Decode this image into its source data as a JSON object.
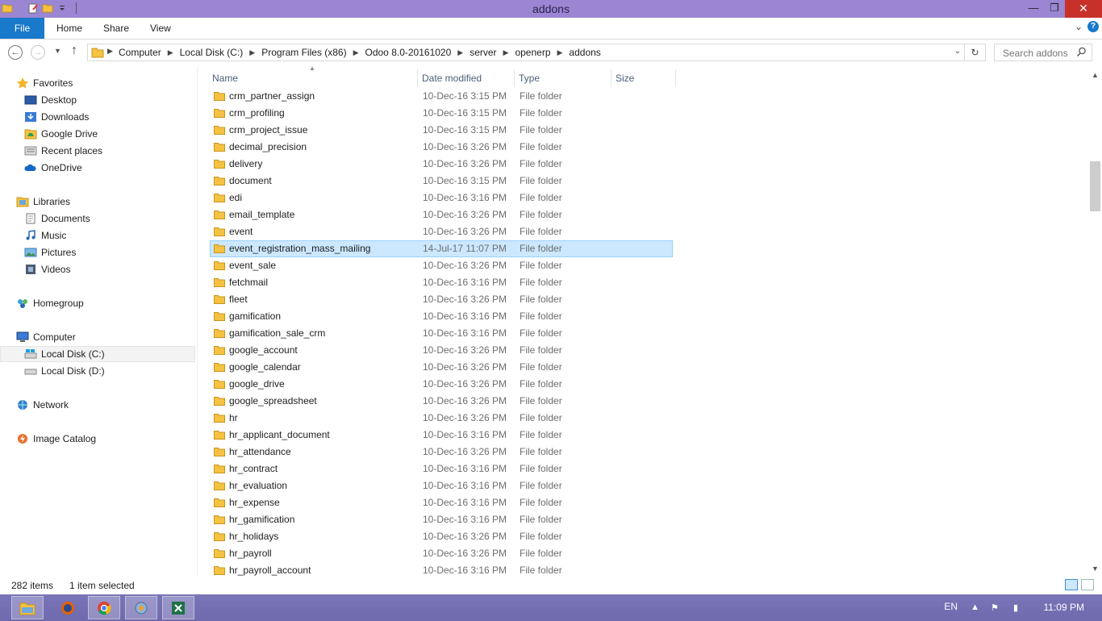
{
  "window": {
    "title": "addons"
  },
  "ribbon": {
    "tabs": [
      "File",
      "Home",
      "Share",
      "View"
    ]
  },
  "navigation": {
    "path": [
      "Computer",
      "Local Disk (C:)",
      "Program Files (x86)",
      "Odoo 8.0-20161020",
      "server",
      "openerp",
      "addons"
    ],
    "search_placeholder": "Search addons"
  },
  "sidebar": {
    "favorites_label": "Favorites",
    "favorites": [
      "Desktop",
      "Downloads",
      "Google Drive",
      "Recent places",
      "OneDrive"
    ],
    "libraries_label": "Libraries",
    "libraries": [
      "Documents",
      "Music",
      "Pictures",
      "Videos"
    ],
    "homegroup_label": "Homegroup",
    "computer_label": "Computer",
    "drives": [
      "Local Disk (C:)",
      "Local Disk (D:)"
    ],
    "network_label": "Network",
    "image_catalog_label": "Image Catalog"
  },
  "columns": {
    "name": "Name",
    "date": "Date modified",
    "type": "Type",
    "size": "Size"
  },
  "files": [
    {
      "name": "crm_partner_assign",
      "date": "10-Dec-16 3:15 PM",
      "type": "File folder"
    },
    {
      "name": "crm_profiling",
      "date": "10-Dec-16 3:15 PM",
      "type": "File folder"
    },
    {
      "name": "crm_project_issue",
      "date": "10-Dec-16 3:15 PM",
      "type": "File folder"
    },
    {
      "name": "decimal_precision",
      "date": "10-Dec-16 3:26 PM",
      "type": "File folder"
    },
    {
      "name": "delivery",
      "date": "10-Dec-16 3:26 PM",
      "type": "File folder"
    },
    {
      "name": "document",
      "date": "10-Dec-16 3:15 PM",
      "type": "File folder"
    },
    {
      "name": "edi",
      "date": "10-Dec-16 3:16 PM",
      "type": "File folder"
    },
    {
      "name": "email_template",
      "date": "10-Dec-16 3:26 PM",
      "type": "File folder"
    },
    {
      "name": "event",
      "date": "10-Dec-16 3:26 PM",
      "type": "File folder"
    },
    {
      "name": "event_registration_mass_mailing",
      "date": "14-Jul-17 11:07 PM",
      "type": "File folder"
    },
    {
      "name": "event_sale",
      "date": "10-Dec-16 3:26 PM",
      "type": "File folder"
    },
    {
      "name": "fetchmail",
      "date": "10-Dec-16 3:16 PM",
      "type": "File folder"
    },
    {
      "name": "fleet",
      "date": "10-Dec-16 3:26 PM",
      "type": "File folder"
    },
    {
      "name": "gamification",
      "date": "10-Dec-16 3:16 PM",
      "type": "File folder"
    },
    {
      "name": "gamification_sale_crm",
      "date": "10-Dec-16 3:16 PM",
      "type": "File folder"
    },
    {
      "name": "google_account",
      "date": "10-Dec-16 3:26 PM",
      "type": "File folder"
    },
    {
      "name": "google_calendar",
      "date": "10-Dec-16 3:26 PM",
      "type": "File folder"
    },
    {
      "name": "google_drive",
      "date": "10-Dec-16 3:26 PM",
      "type": "File folder"
    },
    {
      "name": "google_spreadsheet",
      "date": "10-Dec-16 3:26 PM",
      "type": "File folder"
    },
    {
      "name": "hr",
      "date": "10-Dec-16 3:26 PM",
      "type": "File folder"
    },
    {
      "name": "hr_applicant_document",
      "date": "10-Dec-16 3:16 PM",
      "type": "File folder"
    },
    {
      "name": "hr_attendance",
      "date": "10-Dec-16 3:26 PM",
      "type": "File folder"
    },
    {
      "name": "hr_contract",
      "date": "10-Dec-16 3:16 PM",
      "type": "File folder"
    },
    {
      "name": "hr_evaluation",
      "date": "10-Dec-16 3:16 PM",
      "type": "File folder"
    },
    {
      "name": "hr_expense",
      "date": "10-Dec-16 3:16 PM",
      "type": "File folder"
    },
    {
      "name": "hr_gamification",
      "date": "10-Dec-16 3:16 PM",
      "type": "File folder"
    },
    {
      "name": "hr_holidays",
      "date": "10-Dec-16 3:26 PM",
      "type": "File folder"
    },
    {
      "name": "hr_payroll",
      "date": "10-Dec-16 3:26 PM",
      "type": "File folder"
    },
    {
      "name": "hr_payroll_account",
      "date": "10-Dec-16 3:16 PM",
      "type": "File folder"
    }
  ],
  "selected_row": 9,
  "status": {
    "item_count": "282 items",
    "selection": "1 item selected"
  },
  "taskbar": {
    "language": "EN",
    "time": "11:09 PM"
  },
  "colors": {
    "accent": "#1979ca",
    "titlebar": "#9a86d2",
    "selection": "#cce8ff",
    "taskbar": "#7a75b8",
    "close": "#c7312a"
  }
}
